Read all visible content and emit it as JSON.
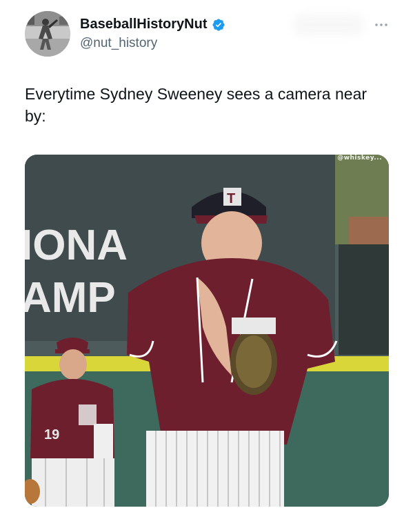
{
  "author": {
    "display_name": "BaseballHistoryNut",
    "handle": "@nut_history",
    "verified": true,
    "avatar_icon": "vintage-baseball-photo"
  },
  "tweet": {
    "text": "Everytime Sydney Sweeney sees a camera near by:"
  },
  "media": {
    "banner_line1": "IONA",
    "banner_line2": "AMP",
    "jersey_number": "19",
    "cap_logo": "T",
    "watermark": "@whiskey..."
  },
  "colors": {
    "verified_blue": "#1d9bf0",
    "maroon": "#6e1f2e",
    "text_primary": "#0f1419",
    "text_secondary": "#536471"
  }
}
